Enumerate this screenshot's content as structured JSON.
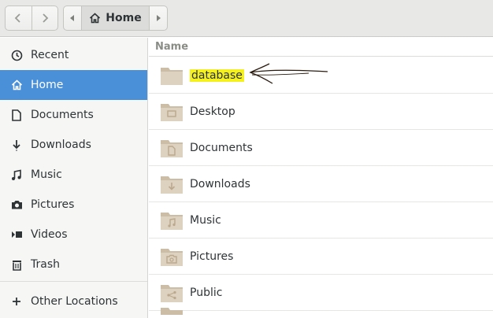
{
  "header": {
    "location": "Home"
  },
  "sidebar": {
    "items": [
      {
        "label": "Recent",
        "icon": "clock-icon"
      },
      {
        "label": "Home",
        "icon": "home-icon",
        "active": true
      },
      {
        "label": "Documents",
        "icon": "document-icon"
      },
      {
        "label": "Downloads",
        "icon": "download-icon"
      },
      {
        "label": "Music",
        "icon": "music-icon"
      },
      {
        "label": "Pictures",
        "icon": "camera-icon"
      },
      {
        "label": "Videos",
        "icon": "video-icon"
      },
      {
        "label": "Trash",
        "icon": "trash-icon"
      }
    ],
    "other": {
      "label": "Other Locations",
      "icon": "plus-icon"
    }
  },
  "main": {
    "column_header": "Name",
    "rows": [
      {
        "label": "database",
        "icon": "folder-icon",
        "highlighted": true
      },
      {
        "label": "Desktop",
        "icon": "folder-desktop-icon"
      },
      {
        "label": "Documents",
        "icon": "folder-documents-icon"
      },
      {
        "label": "Downloads",
        "icon": "folder-downloads-icon"
      },
      {
        "label": "Music",
        "icon": "folder-music-icon"
      },
      {
        "label": "Pictures",
        "icon": "folder-pictures-icon"
      },
      {
        "label": "Public",
        "icon": "folder-public-icon"
      }
    ]
  },
  "colors": {
    "accent": "#4a90d9",
    "highlight": "#f5f120",
    "folder": "#d6c8b4"
  }
}
